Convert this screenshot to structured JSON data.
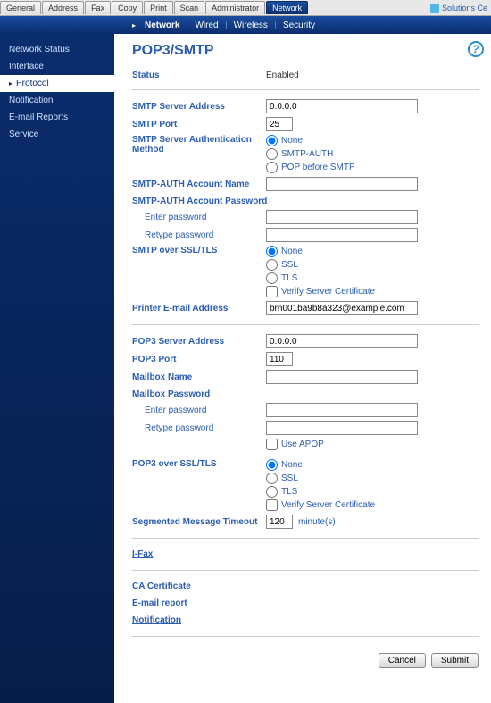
{
  "topTabs": [
    "General",
    "Address",
    "Fax",
    "Copy",
    "Print",
    "Scan",
    "Administrator",
    "Network"
  ],
  "topActive": 7,
  "solutions": "Solutions Ce",
  "subTabs": [
    "Network",
    "Wired",
    "Wireless",
    "Security"
  ],
  "subActive": 0,
  "sidebar": [
    "Network Status",
    "Interface",
    "Protocol",
    "Notification",
    "E-mail Reports",
    "Service"
  ],
  "sidebarActive": 2,
  "title": "POP3/SMTP",
  "labels": {
    "status": "Status",
    "statusVal": "Enabled",
    "smtpAddr": "SMTP Server Address",
    "smtpPort": "SMTP Port",
    "smtpAuth": "SMTP Server Authentication Method",
    "authNone": "None",
    "authSmtp": "SMTP-AUTH",
    "authPop": "POP before SMTP",
    "smtpAcct": "SMTP-AUTH Account Name",
    "smtpPwd": "SMTP-AUTH Account Password",
    "enterPwd": "Enter password",
    "retypePwd": "Retype password",
    "smtpSsl": "SMTP over SSL/TLS",
    "sslNone": "None",
    "ssl": "SSL",
    "tls": "TLS",
    "verify": "Verify Server Certificate",
    "printerEmail": "Printer E-mail Address",
    "pop3Addr": "POP3 Server Address",
    "pop3Port": "POP3 Port",
    "mailbox": "Mailbox Name",
    "mailboxPwd": "Mailbox Password",
    "apop": "Use APOP",
    "pop3Ssl": "POP3 over SSL/TLS",
    "segTimeout": "Segmented Message Timeout",
    "minutes": "minute(s)",
    "ifax": "I-Fax",
    "caCert": "CA Certificate",
    "emailReport": "E-mail report",
    "notification": "Notification",
    "cancel": "Cancel",
    "submit": "Submit"
  },
  "values": {
    "smtpAddr": "0.0.0.0",
    "smtpPort": "25",
    "smtpAuth": "none",
    "smtpAcct": "",
    "smtpPwd1": "",
    "smtpPwd2": "",
    "smtpSsl": "none",
    "smtpVerify": false,
    "printerEmail": "brn001ba9b8a323@example.com",
    "pop3Addr": "0.0.0.0",
    "pop3Port": "110",
    "mailbox": "",
    "mbPwd1": "",
    "mbPwd2": "",
    "apop": false,
    "pop3Ssl": "none",
    "pop3Verify": false,
    "segTimeout": "120"
  }
}
